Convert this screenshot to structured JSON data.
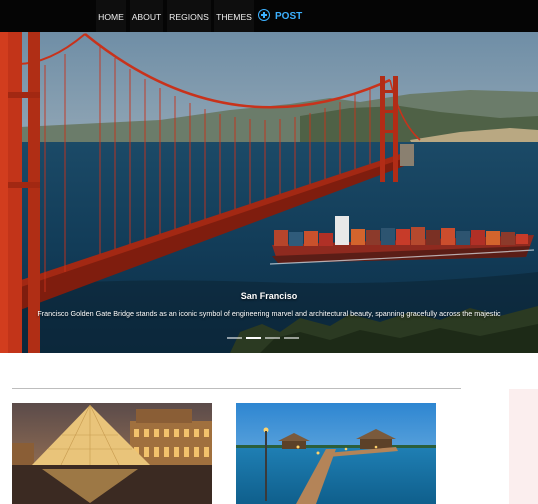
{
  "nav": {
    "items": [
      {
        "label": "HOME"
      },
      {
        "label": "ABOUT"
      },
      {
        "label": "REGIONS"
      },
      {
        "label": "THEMES"
      }
    ],
    "post_label": "POST"
  },
  "hero": {
    "title": "San Franciso",
    "description": "Francisco Golden Gate Bridge stands as an iconic symbol of engineering marvel and architectural beauty, spanning gracefully across the majestic",
    "slide_count": 4,
    "active_slide": 2
  },
  "colors": {
    "nav_background": "#050505",
    "post_accent": "#3db1ff",
    "bridge_red": "#c8321b",
    "sidebar_tint": "#fbeeee"
  },
  "icons": {
    "post": "plus-circle-icon"
  },
  "cards": [
    {
      "image": "louvre-pyramid-image"
    },
    {
      "image": "tropical-pier-image"
    }
  ]
}
